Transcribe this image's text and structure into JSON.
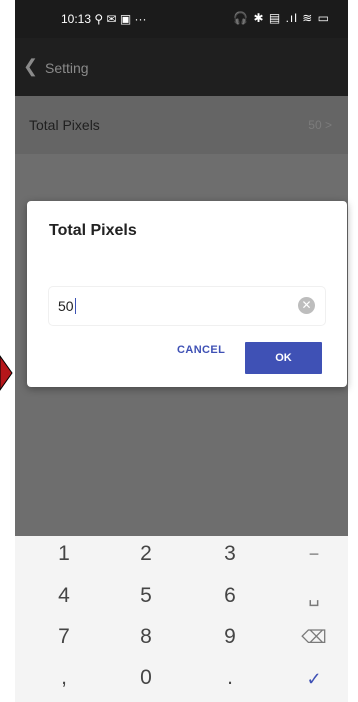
{
  "status_bar": {
    "time_and_icons": "10:13 ⚲ ✉ ▣ ···",
    "right_icons": "🎧 ✱ ▤ .ıl ≋ ▭"
  },
  "app_bar": {
    "title": "Setting"
  },
  "settings_row": {
    "label": "Total Pixels",
    "value": "50 >"
  },
  "dialog": {
    "title": "Total Pixels",
    "input_value": "50",
    "cancel_label": "CANCEL",
    "ok_label": "OK"
  },
  "keyboard": {
    "keys": [
      "1",
      "2",
      "3",
      "−",
      "4",
      "5",
      "6",
      "␣",
      "7",
      "8",
      "9",
      "⌫",
      ",",
      "0",
      ".",
      "✓"
    ]
  },
  "colors": {
    "accent": "#3f51b5",
    "overlay": "#6e6e6e",
    "keyboard": "#f4f4f4"
  }
}
